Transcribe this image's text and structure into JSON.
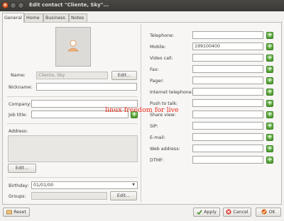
{
  "window": {
    "title": "Edit contact \"Cliente, Sky\"..."
  },
  "window_controls": {
    "close_glyph": "×"
  },
  "tabs": [
    "General",
    "Home",
    "Business",
    "Notes"
  ],
  "active_tab": "General",
  "left": {
    "name_label": "Name:",
    "name_value": "Cliente, Sky",
    "name_edit_label": "Edit...",
    "nickname_label": "Nickname:",
    "nickname_value": "",
    "company_label": "Company:",
    "company_value": "",
    "jobtitle_label": "Job title:",
    "jobtitle_value": "",
    "address_label": "Address:",
    "address_edit_label": "Edit...",
    "birthday_label": "Birthday:",
    "birthday_value": "01/01/00",
    "groups_label": "Groups:",
    "groups_value": "",
    "groups_edit_label": "Edit..."
  },
  "right": {
    "rows": [
      {
        "label": "Telephone:",
        "value": ""
      },
      {
        "label": "Mobile:",
        "value": "199100400"
      },
      {
        "label": "Video call:",
        "value": ""
      },
      {
        "label": "Fax:",
        "value": ""
      },
      {
        "label": "Pager:",
        "value": ""
      },
      {
        "label": "Internet telephone:",
        "value": ""
      },
      {
        "label": "Push to talk:",
        "value": ""
      },
      {
        "label": "Share view:",
        "value": ""
      },
      {
        "label": "SIP:",
        "value": ""
      },
      {
        "label": "E-mail:",
        "value": ""
      },
      {
        "label": "Web address:",
        "value": ""
      },
      {
        "label": "DTMF:",
        "value": ""
      }
    ],
    "add_glyph": "+"
  },
  "watermark": "linux freedom for live",
  "footer": {
    "reset_label": "Reset",
    "apply_label": "Apply",
    "cancel_label": "Cancel",
    "ok_label": "OK"
  },
  "colors": {
    "titlebar": "#3c3b37",
    "close_button": "#e0581f",
    "add_green": "#5aa834",
    "watermark": "#e8291b"
  }
}
